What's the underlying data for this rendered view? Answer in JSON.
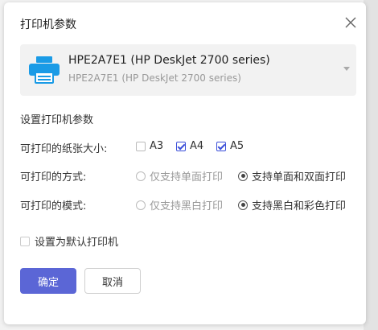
{
  "dialog": {
    "title": "打印机参数",
    "printer": {
      "name": "HPE2A7E1 (HP DeskJet 2700 series)",
      "subtitle": "HPE2A7E1 (HP DeskJet 2700 series)"
    },
    "section_title": "设置打印机参数",
    "paper_size": {
      "label": "可打印的纸张大小:",
      "options": [
        {
          "label": "A3",
          "checked": false
        },
        {
          "label": "A4",
          "checked": true
        },
        {
          "label": "A5",
          "checked": true
        }
      ]
    },
    "print_mode": {
      "label": "可打印的方式:",
      "options": [
        {
          "label": "仅支持单面打印",
          "selected": false
        },
        {
          "label": "支持单面和双面打印",
          "selected": true
        }
      ]
    },
    "color_mode": {
      "label": "可打印的模式:",
      "options": [
        {
          "label": "仅支持黑白打印",
          "selected": false
        },
        {
          "label": "支持黑白和彩色打印",
          "selected": true
        }
      ]
    },
    "default_checkbox": {
      "label": "设置为默认打印机",
      "checked": false
    },
    "ok_label": "确定",
    "cancel_label": "取消"
  },
  "colors": {
    "accent": "#5b66d6",
    "checkbox_check": "#3b4fd9",
    "printer_icon": "#1a9be6"
  }
}
